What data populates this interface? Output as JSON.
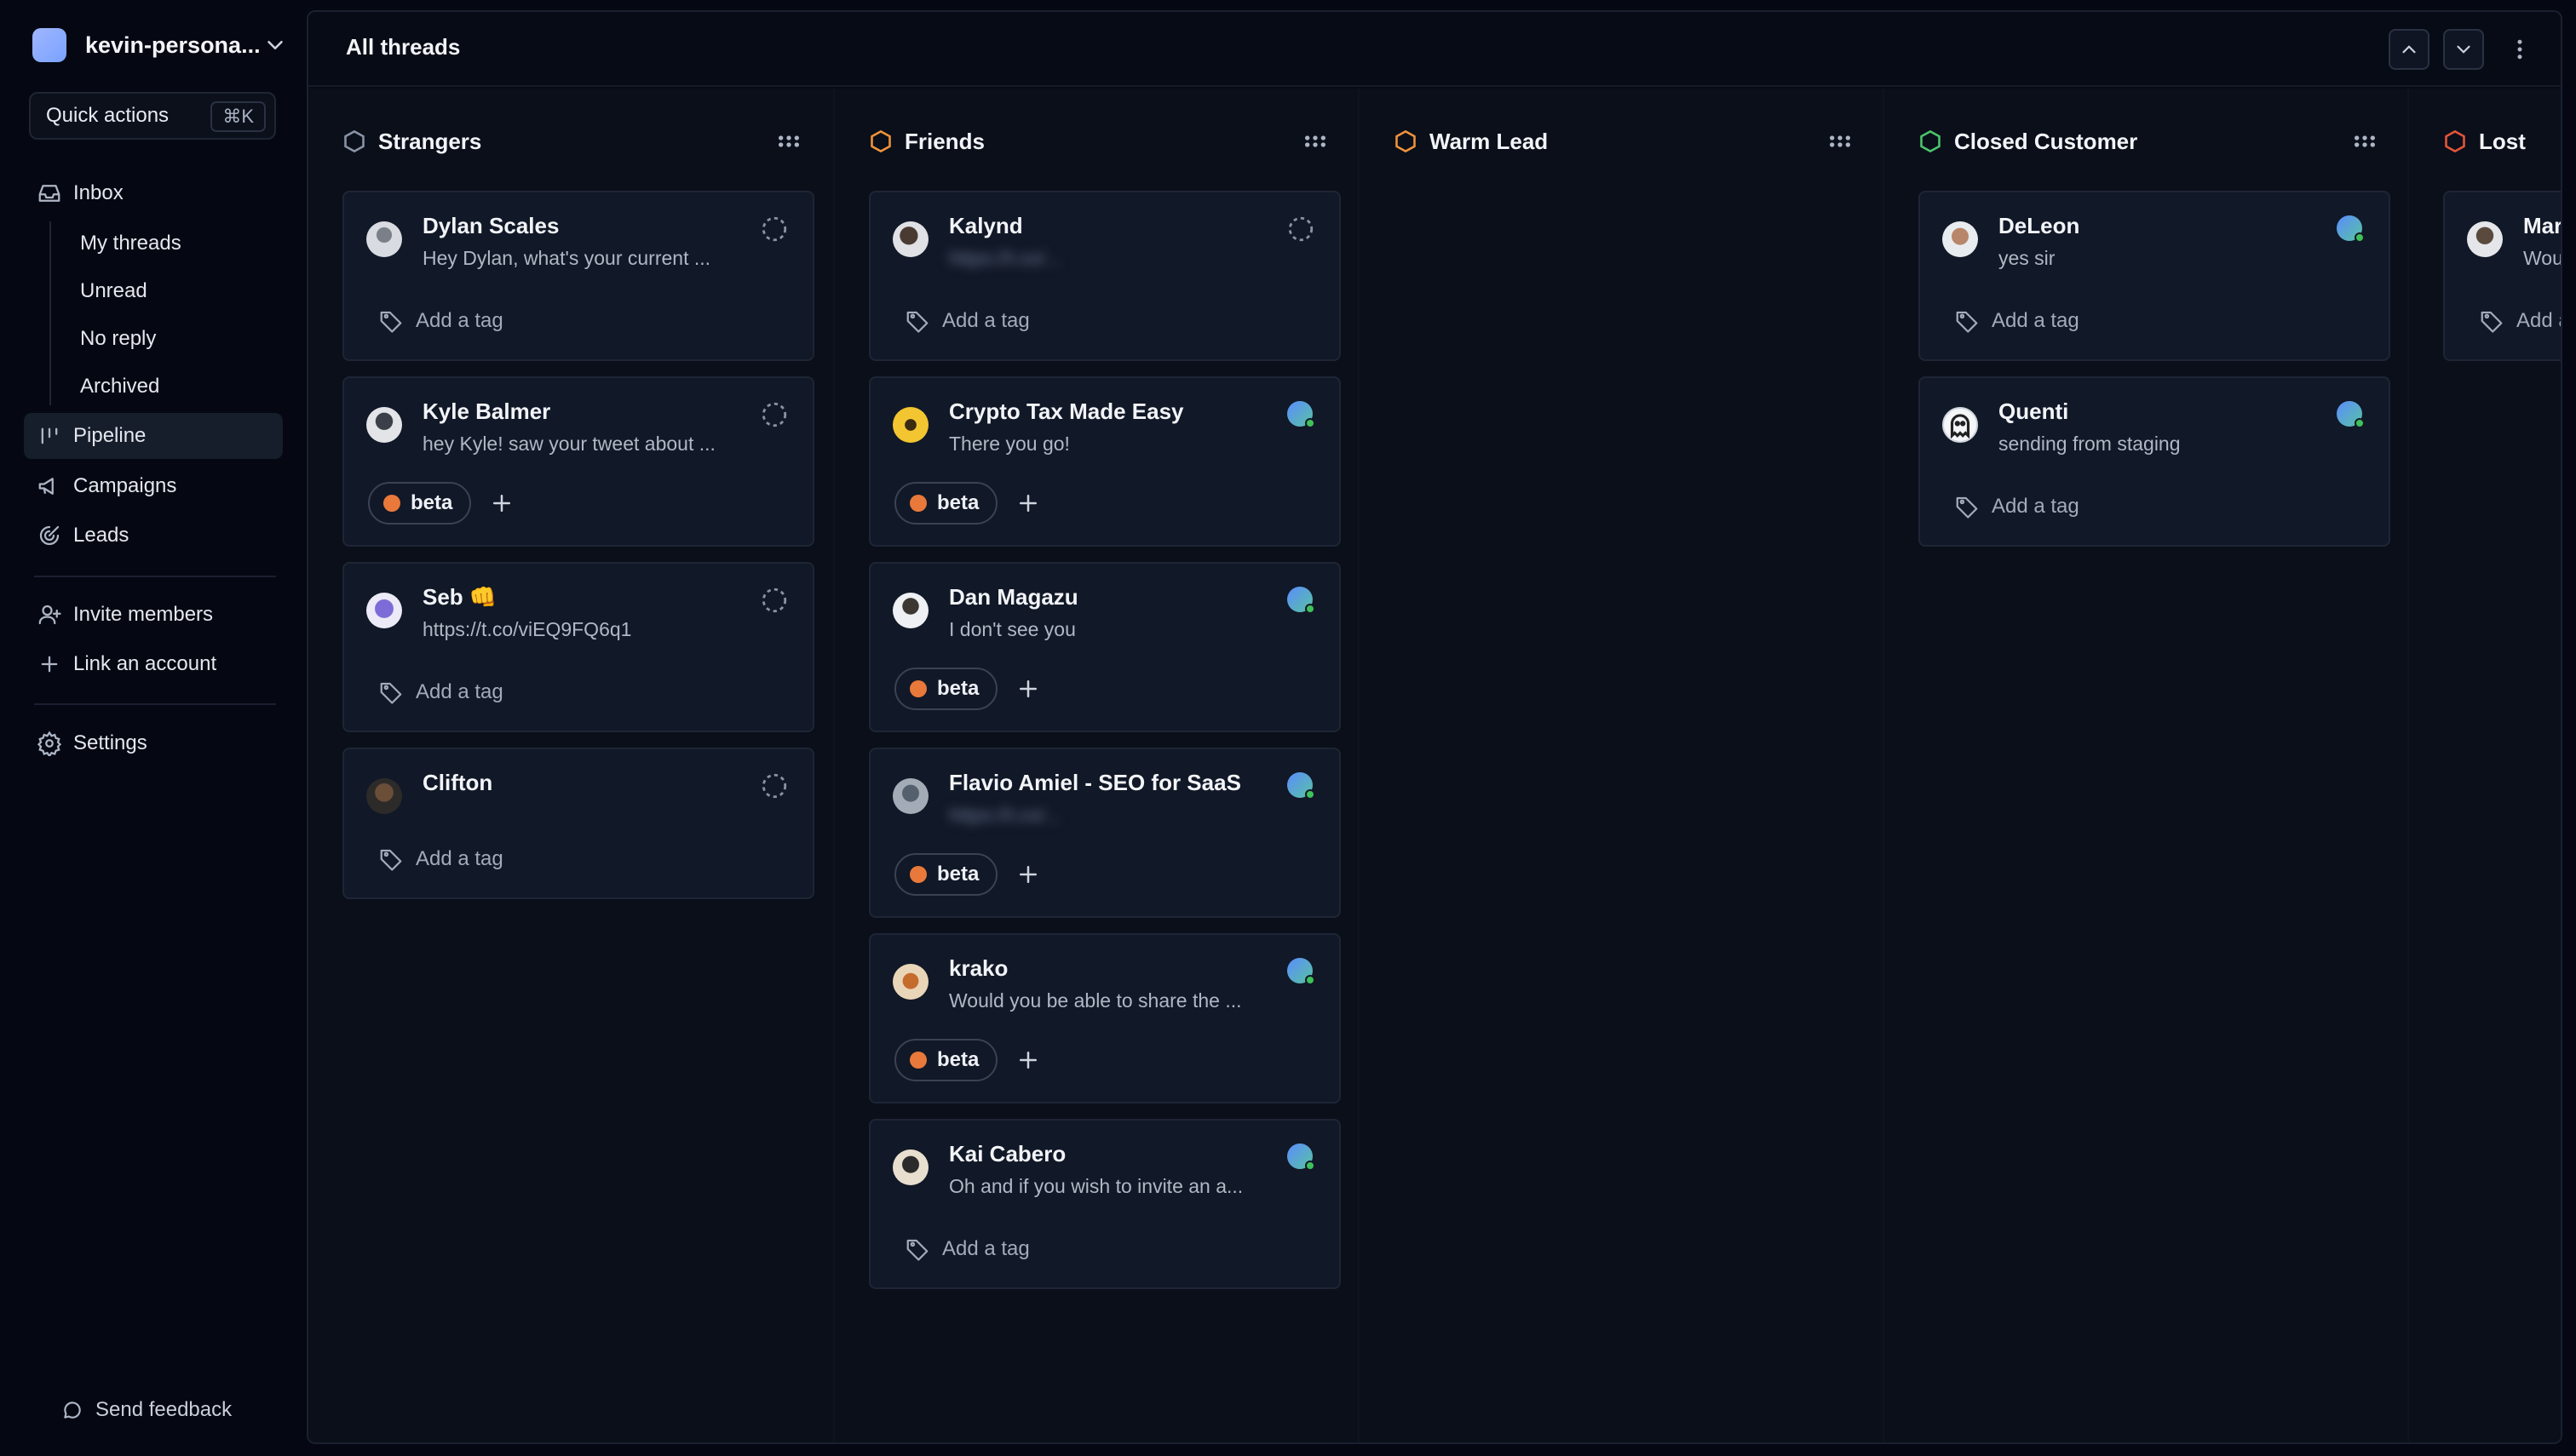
{
  "workspace": {
    "name": "kevin-persona...",
    "avatar_color": "#8fb0ff"
  },
  "quick_actions": {
    "label": "Quick actions",
    "shortcut": "⌘K"
  },
  "nav": {
    "inbox": "Inbox",
    "sub": [
      "My threads",
      "Unread",
      "No reply",
      "Archived"
    ],
    "pipeline": "Pipeline",
    "campaigns": "Campaigns",
    "leads": "Leads",
    "invite": "Invite members",
    "link": "Link an account",
    "settings": "Settings",
    "feedback": "Send feedback"
  },
  "header": {
    "title": "All threads"
  },
  "columns": [
    {
      "title": "Strangers",
      "icon_color": "#8a93a6"
    },
    {
      "title": "Friends",
      "icon_color": "#f0923a"
    },
    {
      "title": "Warm Lead",
      "icon_color": "#f0923a"
    },
    {
      "title": "Closed Customer",
      "icon_color": "#4cc46b"
    },
    {
      "title": "Lost",
      "icon_color": "#e4553a"
    }
  ],
  "tag_placeholder": "Add a tag",
  "tag_label": "beta",
  "colors": {
    "tag_dot": "#e8793a",
    "online": "#3ec25a"
  },
  "cards": {
    "strangers": [
      {
        "name": "Dylan Scales",
        "preview": "Hey Dylan, what's your current ..."
      },
      {
        "name": "Kyle Balmer",
        "preview": "hey Kyle! saw your tweet about ..."
      },
      {
        "name": "Seb 👊",
        "preview": "https://t.co/viEQ9FQ6q1"
      },
      {
        "name": "Clifton",
        "preview": ""
      }
    ],
    "friends": [
      {
        "name": "Kalynd",
        "preview": "https://t.co/..."
      },
      {
        "name": "Crypto Tax Made Easy",
        "preview": "There you go!"
      },
      {
        "name": "Dan Magazu",
        "preview": "I don't see you"
      },
      {
        "name": "Flavio Amiel - SEO for SaaS",
        "preview": "https://t.co/..."
      },
      {
        "name": "krako",
        "preview": "Would you be able to share the ..."
      },
      {
        "name": "Kai Cabero",
        "preview": "Oh and if you wish to invite an a..."
      }
    ],
    "closed": [
      {
        "name": "DeLeon",
        "preview": "yes sir"
      },
      {
        "name": "Quenti",
        "preview": "sending from staging"
      }
    ],
    "lost": [
      {
        "name": "Mar",
        "preview": "Wou"
      }
    ]
  }
}
